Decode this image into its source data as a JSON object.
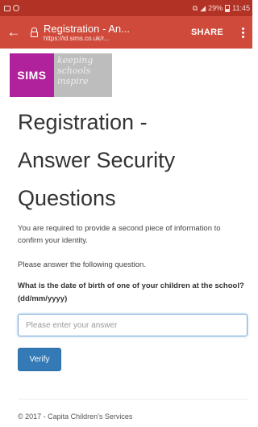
{
  "status_bar": {
    "battery_text": "29%",
    "time": "11:45"
  },
  "toolbar": {
    "title": "Registration - An...",
    "url": "https://id.sims.co.uk/r...",
    "share_label": "SHARE"
  },
  "banner": {
    "logo_text": "SIMS",
    "tagline_lines": [
      "keeping",
      "schools",
      "inspire"
    ]
  },
  "page": {
    "heading_lines": [
      "Registration -",
      "Answer Security",
      "Questions"
    ],
    "intro": "You are required to provide a second piece of information to confirm your identity.",
    "instruction": "Please answer the following question.",
    "question": "What is the date of birth of one of your children at the school? (dd/mm/yyyy)",
    "answer_placeholder": "Please enter your answer",
    "answer_value": "",
    "verify_label": "Verify"
  },
  "footer": {
    "copyright": "© 2017 - Capita Children's Services"
  },
  "colors": {
    "status_bar": "#b23226",
    "toolbar": "#cf4a3a",
    "sims_brand": "#b0229c",
    "primary_button": "#337ab7"
  }
}
